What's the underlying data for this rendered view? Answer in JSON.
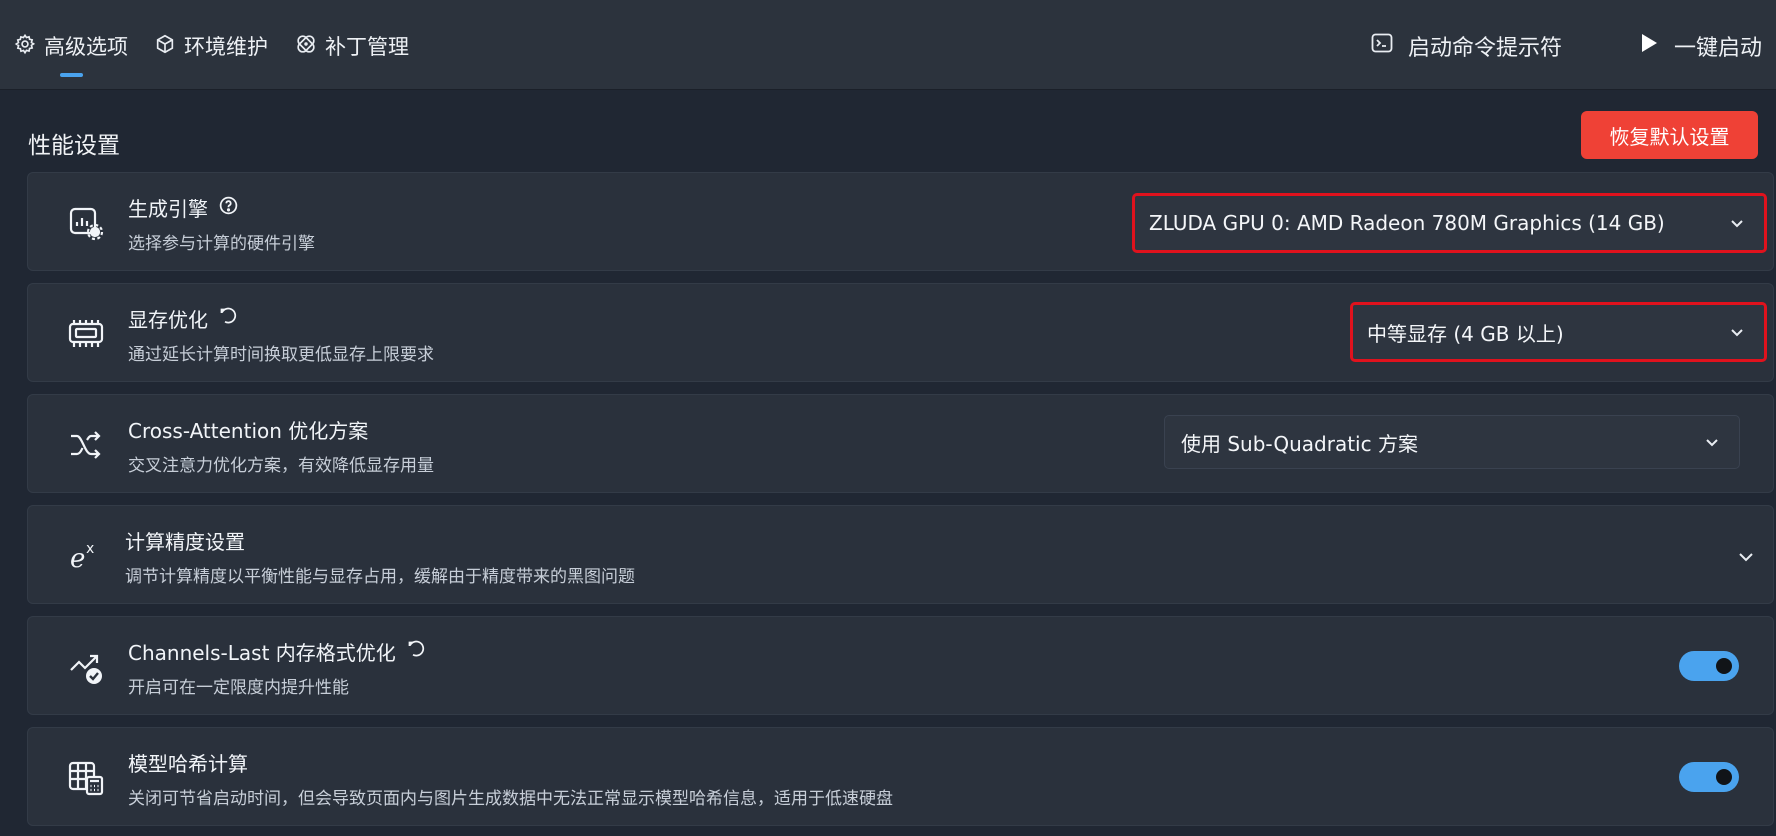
{
  "tabs": [
    {
      "label": "高级选项",
      "icon": "gear-icon"
    },
    {
      "label": "环境维护",
      "icon": "package-icon"
    },
    {
      "label": "补丁管理",
      "icon": "patch-icon"
    }
  ],
  "actions": {
    "terminal_label": "启动命令提示符",
    "launch_label": "一键启动"
  },
  "section": {
    "title": "性能设置",
    "reset_label": "恢复默认设置"
  },
  "settings": [
    {
      "title": "生成引擎",
      "desc": "选择参与计算的硬件引擎",
      "value": "ZLUDA GPU 0: AMD Radeon 780M Graphics (14 GB)",
      "control": "select"
    },
    {
      "title": "显存优化",
      "desc": "通过延长计算时间换取更低显存上限要求",
      "value": "中等显存 (4 GB 以上)",
      "control": "select"
    },
    {
      "title": "Cross-Attention 优化方案",
      "desc": "交叉注意力优化方案，有效降低显存用量",
      "value": "使用 Sub-Quadratic 方案",
      "control": "select"
    },
    {
      "title": "计算精度设置",
      "desc": "调节计算精度以平衡性能与显存占用，缓解由于精度带来的黑图问题",
      "control": "expander"
    },
    {
      "title": "Channels-Last 内存格式优化",
      "desc": "开启可在一定限度内提升性能",
      "control": "toggle",
      "enabled": true
    },
    {
      "title": "模型哈希计算",
      "desc": "关闭可节省启动时间，但会导致页面内与图片生成数据中无法正常显示模型哈希信息，适用于低速硬盘",
      "control": "toggle",
      "enabled": true
    }
  ],
  "colors": {
    "accent": "#4aa3ee",
    "danger": "#ef4136",
    "highlight_border": "#e0121d"
  }
}
